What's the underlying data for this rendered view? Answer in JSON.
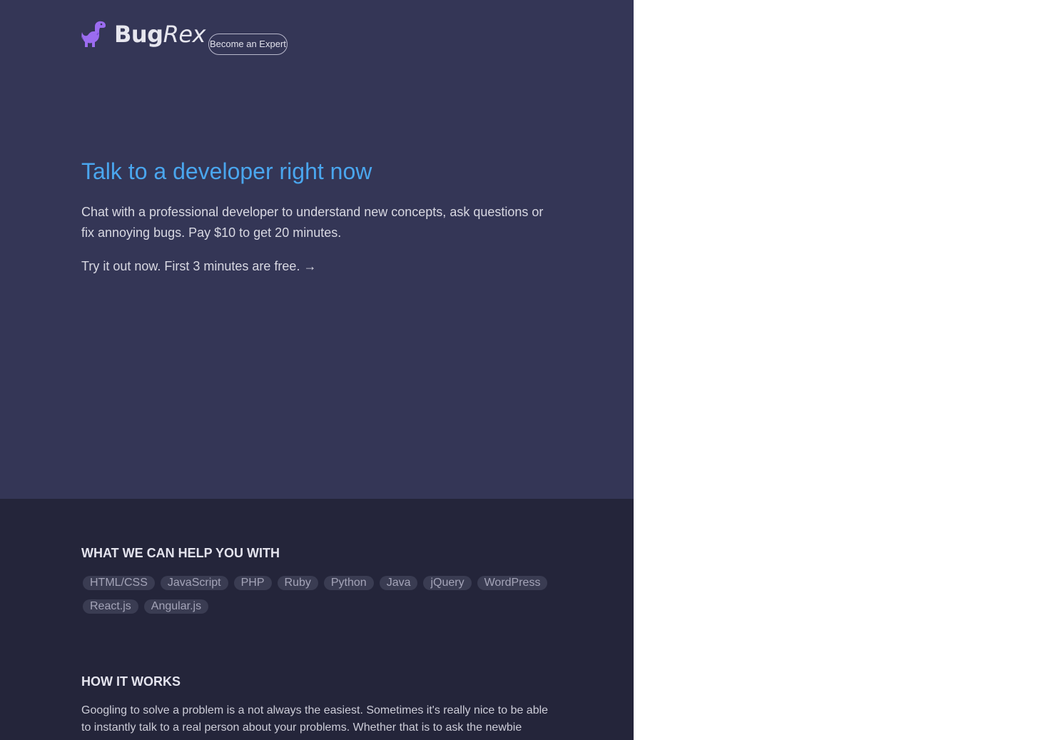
{
  "brand": {
    "name_part1": "Bug",
    "name_part2": "Rex",
    "logo_icon": "dinosaur-icon",
    "logo_color": "#9b6cf0"
  },
  "header": {
    "become_expert_label": "Become an Expert"
  },
  "hero": {
    "title": "Talk to a developer right now",
    "description": "Chat with a professional developer to understand new concepts, ask questions or fix annoying bugs. Pay $10 to get 20 minutes.",
    "cta": "Try it out now. First 3 minutes are free. →"
  },
  "help": {
    "title": "WHAT WE CAN HELP YOU WITH",
    "tags": [
      "HTML/CSS",
      "JavaScript",
      "PHP",
      "Ruby",
      "Python",
      "Java",
      "jQuery",
      "WordPress",
      "React.js",
      "Angular.js"
    ]
  },
  "how": {
    "title": "HOW IT WORKS",
    "text": "Googling to solve a problem is a not always the easiest. Sometimes it's really nice to be able to instantly talk to a real person about your problems. Whether that is to ask the newbie"
  },
  "colors": {
    "hero_bg": "#343656",
    "lower_bg": "#24253a",
    "accent": "#4aa6ee"
  }
}
